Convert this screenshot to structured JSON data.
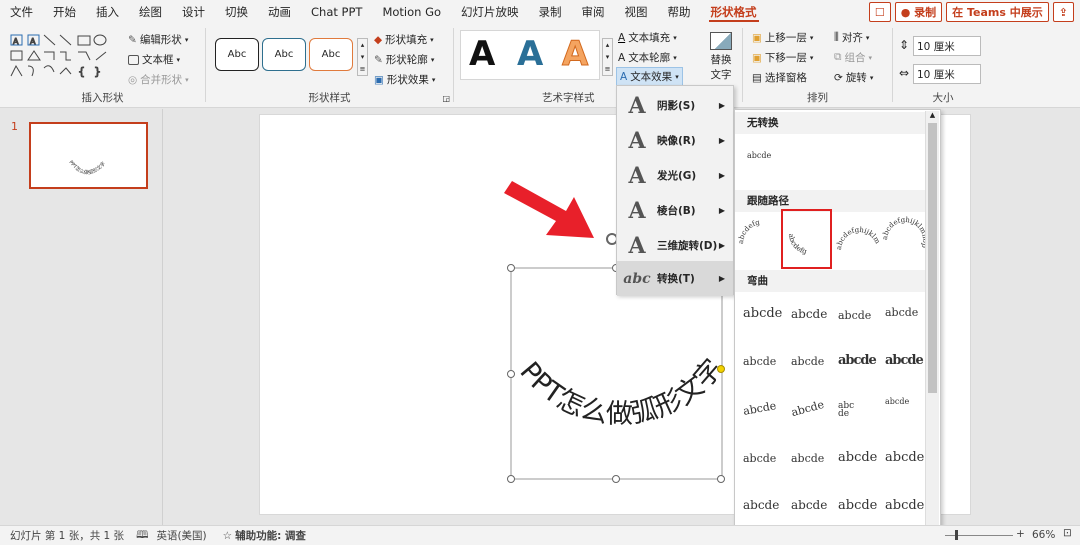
{
  "tabs": [
    "文件",
    "开始",
    "插入",
    "绘图",
    "设计",
    "切换",
    "动画",
    "Chat PPT",
    "Motion Go",
    "幻灯片放映",
    "录制",
    "审阅",
    "视图",
    "帮助",
    "形状格式"
  ],
  "tab_buttons": {
    "comment": "☐",
    "record": "● 录制",
    "teams": "在 Teams 中展示",
    "share": "⇪"
  },
  "ribbon": {
    "insert_shapes": {
      "label": "插入形状",
      "edit_shape": "编辑形状",
      "text_box": "文本框",
      "merge_shapes": "合并形状"
    },
    "shape_styles": {
      "label": "形状样式",
      "samples": [
        "Abc",
        "Abc",
        "Abc"
      ],
      "fill": "形状填充",
      "outline": "形状轮廓",
      "effects": "形状效果"
    },
    "wordart_styles": {
      "label": "艺术字样式",
      "samples": [
        "A",
        "A",
        "A"
      ],
      "text_fill": "文本填充",
      "text_outline": "文本轮廓",
      "text_effects": "文本效果"
    },
    "alt_text": {
      "line1": "替换",
      "line2": "文字"
    },
    "arrange": {
      "label": "排列",
      "bring_forward": "上移一层",
      "send_backward": "下移一层",
      "selection_pane": "选择窗格",
      "align": "对齐",
      "group": "组合",
      "rotate": "旋转"
    },
    "size": {
      "label": "大小",
      "height": "10 厘米",
      "width": "10 厘米"
    }
  },
  "slide_panel": {
    "number": "1",
    "thumb_text": "PPT怎么做弧形文字"
  },
  "slide": {
    "arc_text": "PPT怎么做弧形文字"
  },
  "effects_menu": {
    "items": [
      {
        "label": "阴影(S)",
        "icon": "A"
      },
      {
        "label": "映像(R)",
        "icon": "A"
      },
      {
        "label": "发光(G)",
        "icon": "A"
      },
      {
        "label": "棱台(B)",
        "icon": "A"
      },
      {
        "label": "三维旋转(D)",
        "icon": "A"
      },
      {
        "label": "转换(T)",
        "icon": "abc"
      }
    ]
  },
  "transform_gallery": {
    "no_transform": {
      "header": "无转换",
      "sample": "abcde"
    },
    "follow_path": {
      "header": "跟随路径"
    },
    "warp": {
      "header": "弯曲",
      "sample": "abcde"
    }
  },
  "status": {
    "slide_info": "幻灯片 第 1 张，共 1 张",
    "language": "英语(美国)",
    "accessibility": "辅助功能: 调查",
    "zoom": "66%"
  },
  "colors": {
    "accent": "#c43e1c",
    "arrow": "#e8202a",
    "highlight_box": "#e02020"
  }
}
